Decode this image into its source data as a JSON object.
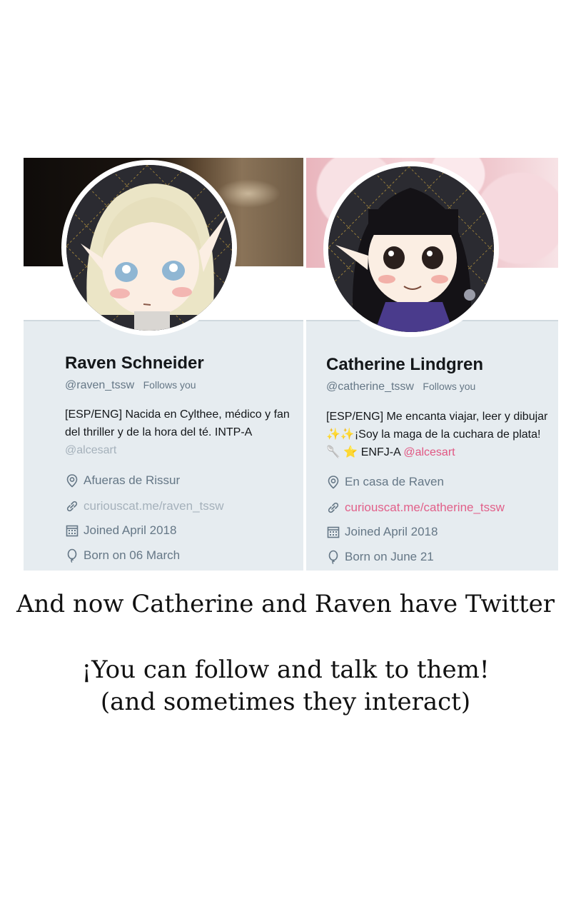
{
  "profiles": [
    {
      "name": "Raven Schneider",
      "handle": "@raven_tssw",
      "follows_you": "Follows you",
      "bio_text": "[ESP/ENG] Nacida en Cylthee, médico y fan del thriller y de la hora del té. INTP-A",
      "bio_mention": "@alcesart",
      "location": "Afueras de Rissur",
      "website": "curiouscat.me/raven_tssw",
      "joined": "Joined April 2018",
      "born": "Born on 06 March",
      "link_color": "#a5b1bb"
    },
    {
      "name": "Catherine Lindgren",
      "handle": "@catherine_tssw",
      "follows_you": "Follows you",
      "bio_text_1": "[ESP/ENG] Me encanta viajar, leer y dibujar",
      "bio_emoji_1": "✨✨",
      "bio_text_2": "¡Soy la maga de la cuchara de plata!",
      "bio_emoji_2": "🥄 ⭐",
      "bio_text_3": "ENFJ-A",
      "bio_mention": "@alcesart",
      "location": "En casa de Raven",
      "website": "curiouscat.me/catherine_tssw",
      "joined": "Joined April 2018",
      "born": "Born on June 21",
      "link_color": "#e0245e"
    }
  ],
  "icons": {
    "location": "location-pin-icon",
    "link": "link-icon",
    "calendar": "calendar-icon",
    "birthday": "balloon-icon"
  },
  "caption": {
    "line1": "And now Catherine and Raven have Twitter",
    "line2": "¡You can follow and talk to them!",
    "line3": "(and sometimes they interact)"
  }
}
